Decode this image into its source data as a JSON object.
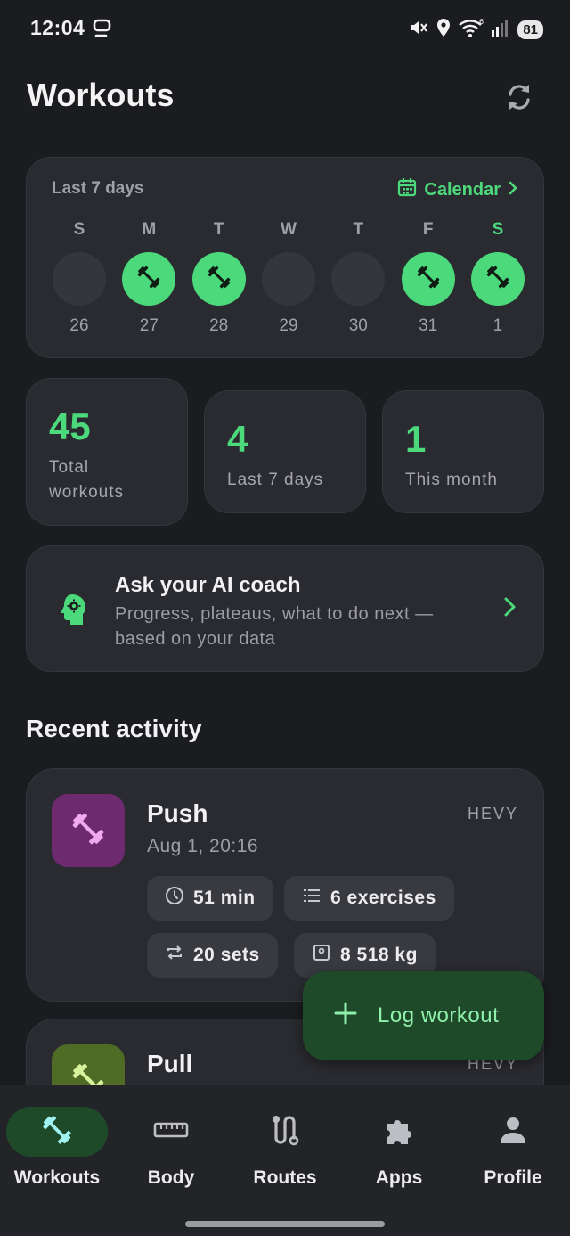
{
  "status_bar": {
    "time": "12:04",
    "battery": "81"
  },
  "header": {
    "title": "Workouts"
  },
  "week": {
    "label": "Last 7 days",
    "calendar_link": "Calendar",
    "days": [
      {
        "letter": "S",
        "date": "26",
        "done": false
      },
      {
        "letter": "M",
        "date": "27",
        "done": true
      },
      {
        "letter": "T",
        "date": "28",
        "done": true
      },
      {
        "letter": "W",
        "date": "29",
        "done": false
      },
      {
        "letter": "T",
        "date": "30",
        "done": false
      },
      {
        "letter": "F",
        "date": "31",
        "done": true
      },
      {
        "letter": "S",
        "date": "1",
        "done": true,
        "today": true
      }
    ]
  },
  "stats": [
    {
      "value": "45",
      "label_line1": "Total",
      "label_line2": "workouts"
    },
    {
      "value": "4",
      "label_line1": "Last 7 days"
    },
    {
      "value": "1",
      "label_line1": "This month"
    }
  ],
  "coach": {
    "title": "Ask your AI coach",
    "description_line1": "Progress, plateaus, what to do next —",
    "description_line2": "based on your data"
  },
  "recent": {
    "title": "Recent activity",
    "items": [
      {
        "name": "Push",
        "date": "Aug 1, 20:16",
        "source": "HEVY",
        "duration": "51 min",
        "exercises": "6 exercises",
        "sets": "20 sets",
        "volume": "8 518 kg"
      },
      {
        "name": "Pull",
        "source": "HEVY"
      }
    ]
  },
  "fab": {
    "label": "Log workout"
  },
  "nav": [
    {
      "label": "Workouts",
      "active": true
    },
    {
      "label": "Body"
    },
    {
      "label": "Routes"
    },
    {
      "label": "Apps"
    },
    {
      "label": "Profile"
    }
  ],
  "colors": {
    "accent": "#4cd97b",
    "background": "#1b1c1f",
    "card": "#2a2b30",
    "push_thumb": "#6e2a6e",
    "pull_thumb": "#4f6b25",
    "fab_bg": "#1f4a2a"
  },
  "icons": {
    "sync": "sync-icon",
    "calendar": "calendar-icon",
    "dumbbell": "dumbbell-icon",
    "coach": "brain-head-icon",
    "clock": "clock-icon",
    "list": "list-icon",
    "repeat": "repeat-icon",
    "weight": "weight-icon",
    "plus": "plus-icon",
    "ruler": "ruler-icon",
    "route": "route-icon",
    "puzzle": "puzzle-icon",
    "person": "person-icon"
  }
}
